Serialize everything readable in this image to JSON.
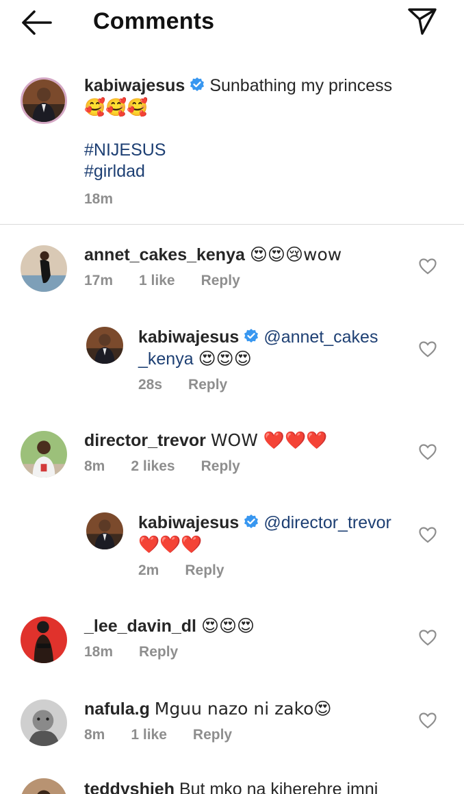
{
  "header": {
    "title": "Comments"
  },
  "caption": {
    "username": "kabiwajesus",
    "text": "Sunbathing my princess",
    "emojis": "🥰🥰🥰",
    "hashtags": [
      "#NIJESUS",
      "#girldad"
    ],
    "time": "18m"
  },
  "comments": [
    {
      "username": "annet_cakes_kenya",
      "text": "😍😍😢wow",
      "time": "17m",
      "likes": "1 like",
      "reply": "Reply"
    },
    {
      "username": "kabiwajesus",
      "mention": "@annet_cakes",
      "mention_cont": "_kenya",
      "text": "😍😍😍",
      "time": "28s",
      "reply": "Reply"
    },
    {
      "username": "director_trevor",
      "text": "WOW ❤️❤️❤️",
      "time": "8m",
      "likes": "2 likes",
      "reply": "Reply"
    },
    {
      "username": "kabiwajesus",
      "mention": "@director_trevor",
      "text": "❤️❤️❤️",
      "time": "2m",
      "reply": "Reply"
    },
    {
      "username": "_lee_davin_dl",
      "text": "😍😍😍",
      "time": "18m",
      "reply": "Reply"
    },
    {
      "username": "nafula.g",
      "text": "Mguu nazo ni zako😍",
      "time": "8m",
      "likes": "1 like",
      "reply": "Reply"
    },
    {
      "username": "teddyshieh",
      "text": "But mko na kiherehre imni"
    }
  ],
  "colors": {
    "link": "#1d3f73",
    "verified": "#3897f0",
    "meta": "#8e8e8e",
    "divider": "#dbdbdb"
  }
}
